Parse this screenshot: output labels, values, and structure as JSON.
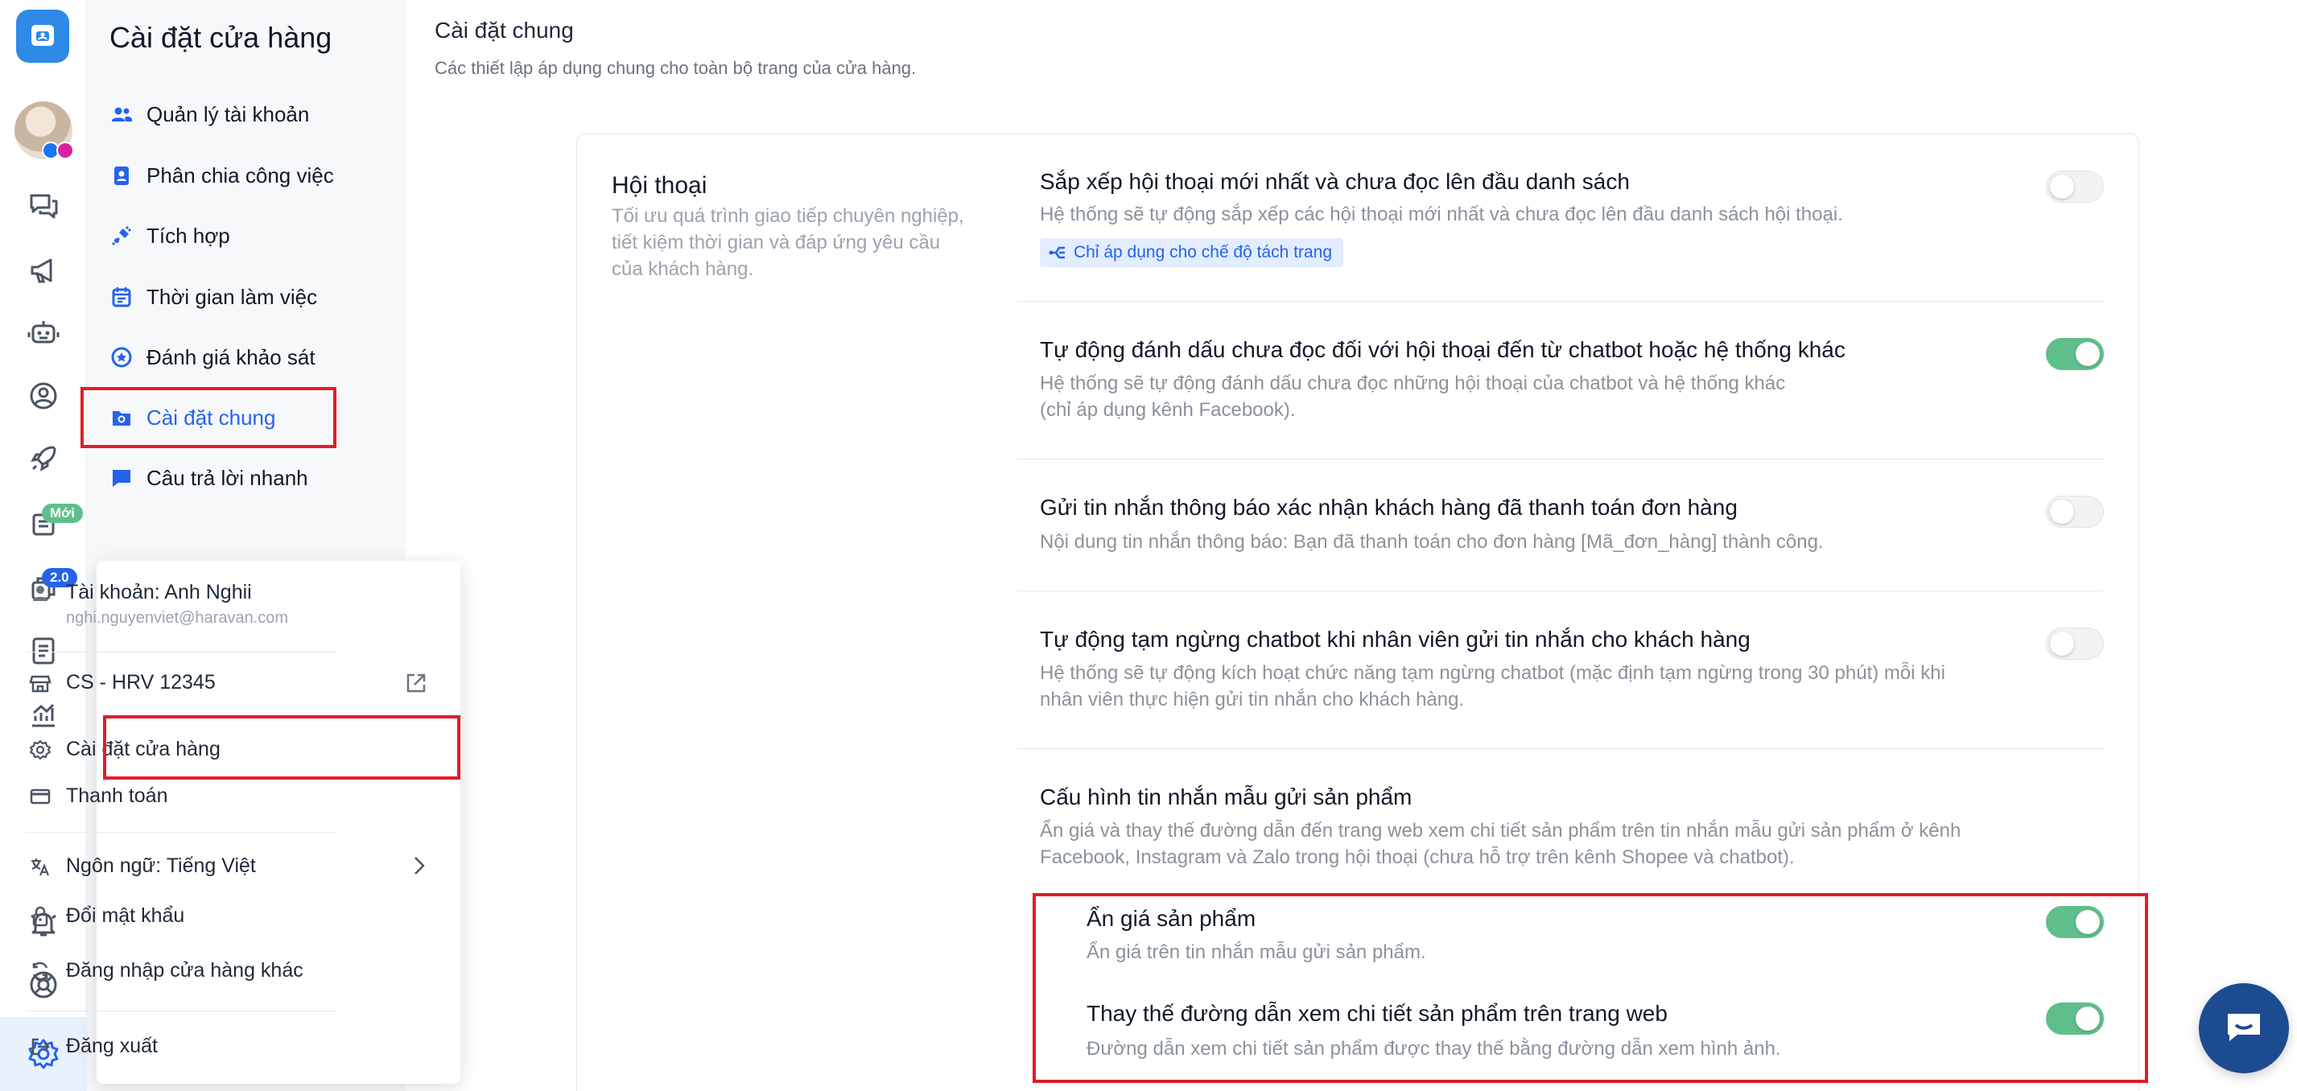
{
  "rail": {
    "badge_new": "Mới",
    "badge_version": "2.0"
  },
  "side": {
    "title": "Cài đặt cửa hàng",
    "items": [
      {
        "label": "Quản lý tài khoản",
        "icon": "users-icon"
      },
      {
        "label": "Phân chia công việc",
        "icon": "badge-icon"
      },
      {
        "label": "Tích hợp",
        "icon": "plug-icon"
      },
      {
        "label": "Thời gian làm việc",
        "icon": "calendar-icon"
      },
      {
        "label": "Đánh giá khảo sát",
        "icon": "star-icon"
      },
      {
        "label": "Cài đặt chung",
        "icon": "folder-gear-icon",
        "active": true
      },
      {
        "label": "Câu trả lời nhanh",
        "icon": "chat-icon"
      }
    ]
  },
  "popover": {
    "account_label": "Tài khoản: Anh Nghii",
    "email": "nghi.nguyenviet@haravan.com",
    "store_name": "CS - HRV 12345",
    "store_settings": "Cài đặt cửa hàng",
    "billing": "Thanh toán",
    "language": "Ngôn ngữ: Tiếng Việt",
    "change_password": "Đổi mật khẩu",
    "switch_store": "Đăng nhập cửa hàng khác",
    "logout": "Đăng xuất"
  },
  "main": {
    "title": "Cài đặt chung",
    "description": "Các thiết lập áp dụng chung cho toàn bộ trang của cửa hàng.",
    "section": {
      "title": "Hội thoại",
      "description": "Tối ưu quá trình giao tiếp chuyên nghiệp, tiết kiệm thời gian và đáp ứng yêu cầu của khách hàng."
    },
    "settings": [
      {
        "title": "Sắp xếp hội thoại mới nhất và chưa đọc lên đầu danh sách",
        "desc": "Hệ thống sẽ tự động sắp xếp các hội thoại mới nhất và chưa đọc lên đầu danh sách hội thoại.",
        "tag": "Chỉ áp dụng cho chế độ tách trang",
        "enabled": false
      },
      {
        "title": "Tự động đánh dấu chưa đọc đối với hội thoại đến từ chatbot hoặc hệ thống khác",
        "desc_line1": "Hệ thống sẽ tự động đánh dấu chưa đọc những hội thoại của chatbot và hệ thống khác",
        "desc_line2": "(chỉ áp dụng kênh Facebook).",
        "enabled": true
      },
      {
        "title": "Gửi tin nhắn thông báo xác nhận khách hàng đã thanh toán đơn hàng",
        "desc": "Nội dung tin nhắn thông báo: Bạn đã thanh toán cho đơn hàng [Mã_đơn_hàng] thành công.",
        "enabled": false
      },
      {
        "title": "Tự động tạm ngừng chatbot khi nhân viên gửi tin nhắn cho khách hàng",
        "desc_line1": "Hệ thống sẽ tự động kích hoạt chức năng tạm ngừng chatbot (mặc định tạm ngừng trong 30 phút) mỗi khi",
        "desc_line2": "nhân viên thực hiện gửi tin nhắn cho khách hàng.",
        "enabled": false
      },
      {
        "title": "Cấu hình tin nhắn mẫu gửi sản phẩm",
        "desc_line1": "Ẩn giá và thay thế đường dẫn đến trang web xem chi tiết sản phẩm trên tin nhắn mẫu gửi sản phẩm ở kênh",
        "desc_line2": "Facebook, Instagram và Zalo trong hội thoại (chưa hỗ trợ trên kênh Shopee và chatbot)."
      }
    ],
    "sub_settings": [
      {
        "title": "Ẩn giá sản phẩm",
        "desc": "Ẩn giá trên tin nhắn mẫu gửi sản phẩm.",
        "enabled": true
      },
      {
        "title": "Thay thế đường dẫn xem chi tiết sản phẩm trên trang web",
        "desc": "Đường dẫn xem chi tiết sản phẩm được thay thế bằng đường dẫn xem hình ảnh.",
        "enabled": true
      }
    ]
  },
  "colors": {
    "accent": "#2563eb",
    "toggle_on": "#5fbf8b",
    "highlight": "#e11d2a",
    "logo": "#2e8ae6"
  }
}
